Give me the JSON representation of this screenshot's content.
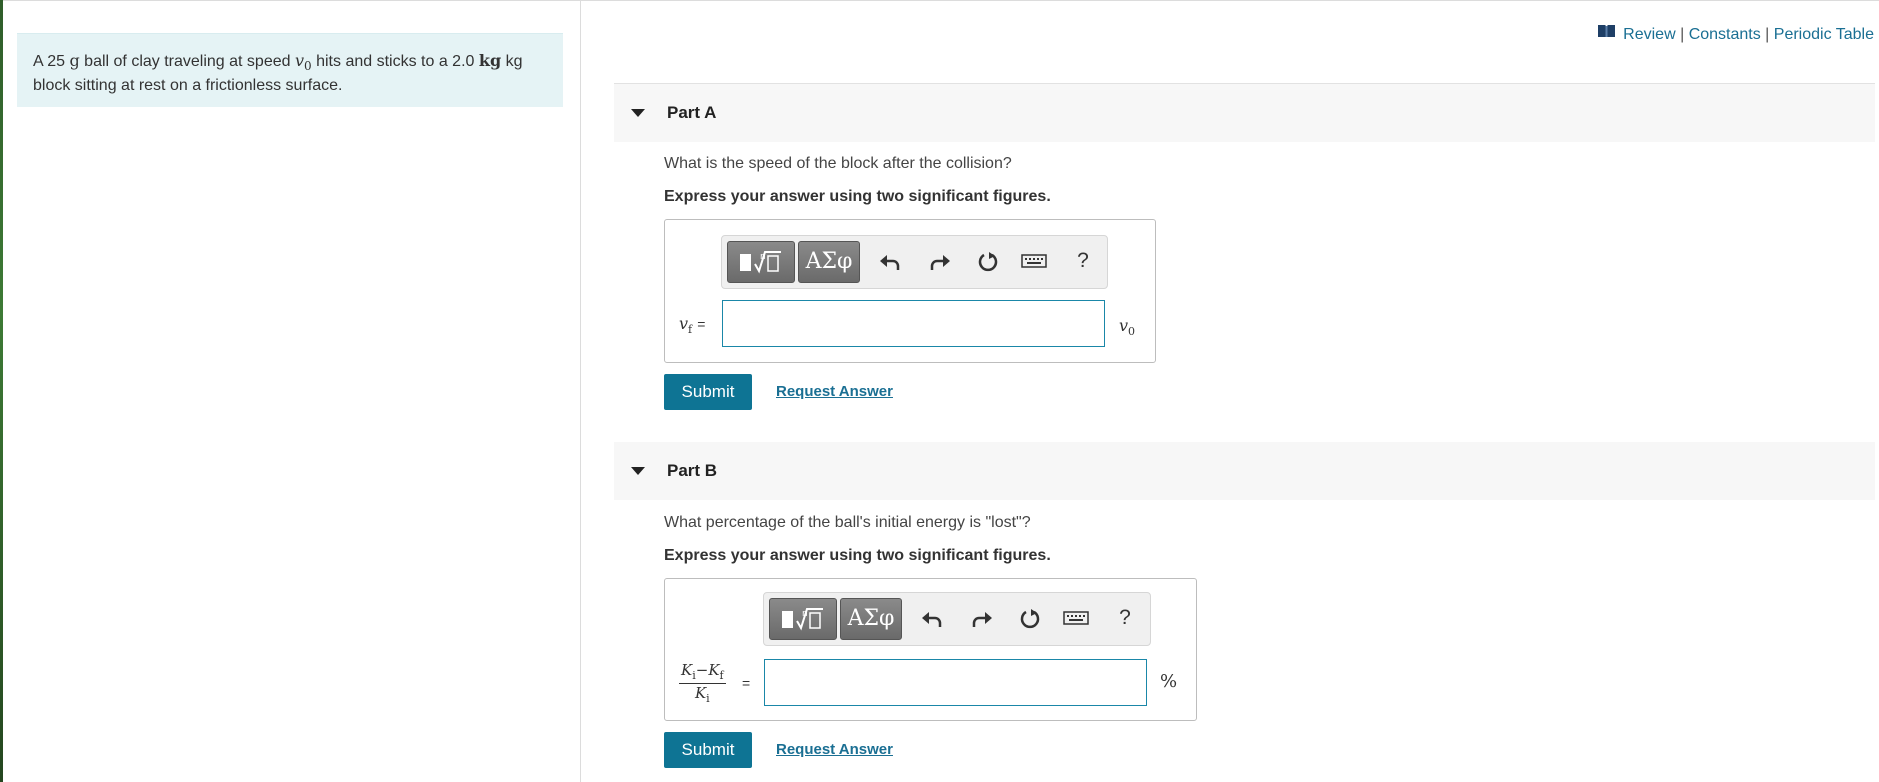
{
  "problem": {
    "text_1": "A 25 ",
    "mass_unit": "g",
    "text_2": " ball of clay traveling at speed ",
    "speed_symbol": "v",
    "speed_sub": "0",
    "text_3": " hits and sticks to a 2.0 ",
    "block_unit": "kg",
    "text_4": " kg",
    "text_5": "block sitting at rest on a frictionless surface."
  },
  "links": {
    "review": "Review",
    "sep1": " | ",
    "constants": "Constants",
    "sep2": " | ",
    "periodic": "Periodic Table"
  },
  "partA": {
    "title": "Part A",
    "question": "What is the speed of the block after the collision?",
    "instruction": "Express your answer using two significant figures.",
    "var_label": "v",
    "var_sub": "f",
    "equals": "=",
    "unit_symbol": "v",
    "unit_sub": "0",
    "input_value": "",
    "submit": "Submit",
    "request": "Request Answer"
  },
  "partB": {
    "title": "Part B",
    "question": "What percentage of the ball's initial energy is \"lost\"?",
    "instruction": "Express your answer using two significant figures.",
    "frac_num_a": "K",
    "frac_num_a_sub": "i",
    "frac_minus": "−",
    "frac_num_b": "K",
    "frac_num_b_sub": "f",
    "frac_den": "K",
    "frac_den_sub": "i",
    "equals": "=",
    "unit": "%",
    "input_value": "",
    "submit": "Submit",
    "request": "Request Answer"
  },
  "toolbar": {
    "greek": "ΑΣφ",
    "help": "?"
  }
}
